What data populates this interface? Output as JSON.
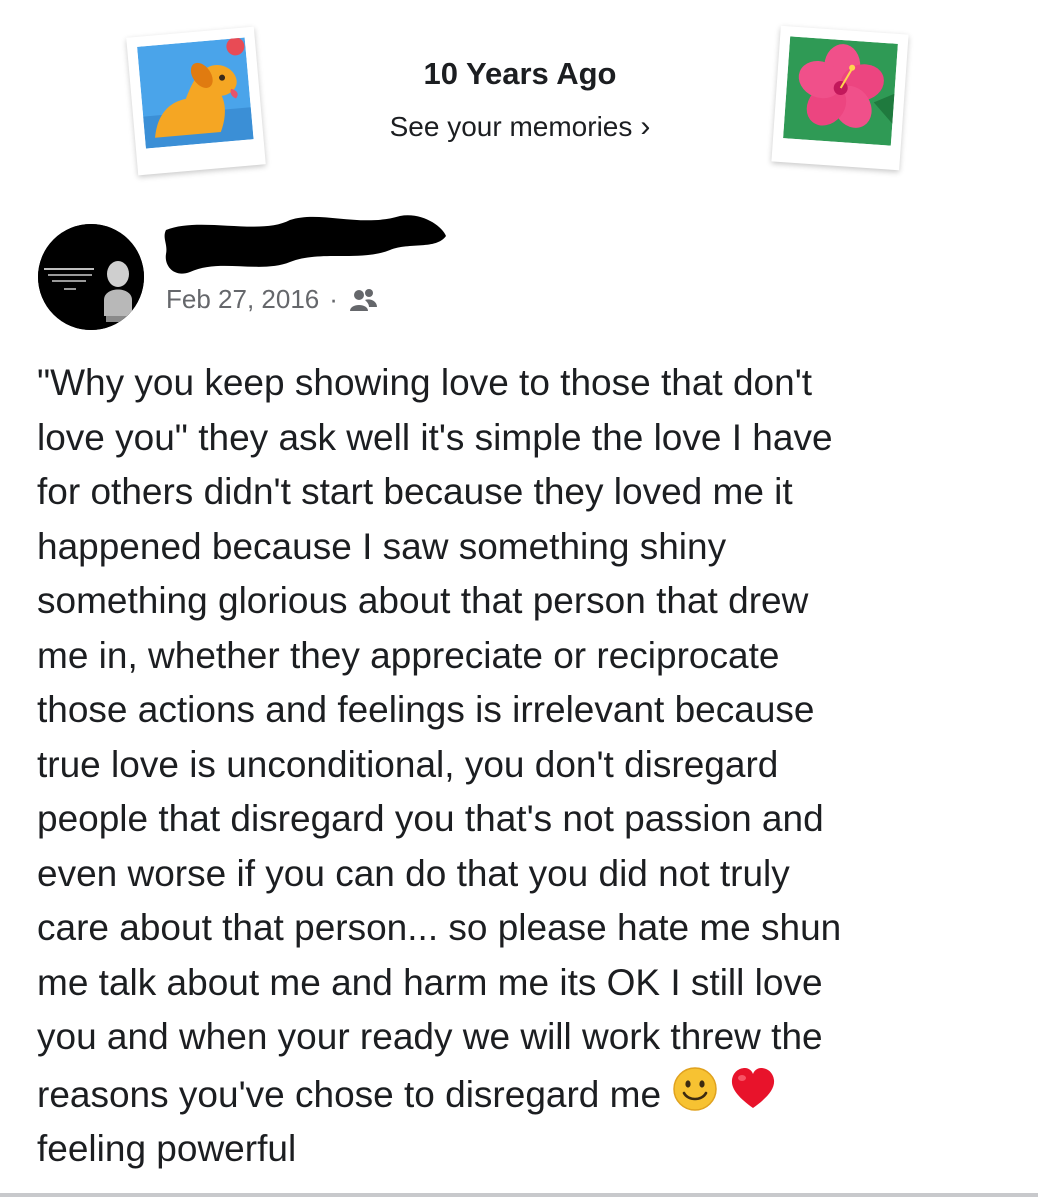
{
  "memories": {
    "title": "10 Years Ago",
    "link_label": "See your memories",
    "left_illustration": "dog-with-ball-illustration",
    "right_illustration": "hibiscus-flower-illustration"
  },
  "post": {
    "author_avatar": "philosopher-bust-quote-avatar",
    "author_name_redacted": true,
    "date": "Feb 27, 2016",
    "separator": "·",
    "audience_icon": "friends-icon",
    "body_lines": [
      "\"Why you keep showing love to those that don't",
      "love you\" they ask well it's simple the love I have",
      "for others didn't start because they loved me it",
      "happened because I saw something shiny",
      "something glorious about that person that drew",
      "me in, whether they appreciate or reciprocate",
      "those actions and feelings is irrelevant because",
      "true love is unconditional, you don't disregard",
      "people that disregard you that's not passion and",
      "even worse if you can do that you did not truly",
      "care about that person... so please hate me shun",
      "me talk about me and harm me its OK I still love",
      "you and when your ready we will work threw the",
      "reasons you've chose to disregard me"
    ],
    "emojis": [
      "smiling-face-emoji",
      "red-heart-emoji"
    ],
    "feeling": "feeling powerful"
  },
  "colors": {
    "text": "#1c1e21",
    "meta": "#65676b",
    "avatar_bg": "#000000",
    "heart": "#e8132b",
    "smiley": "#f7c232"
  }
}
